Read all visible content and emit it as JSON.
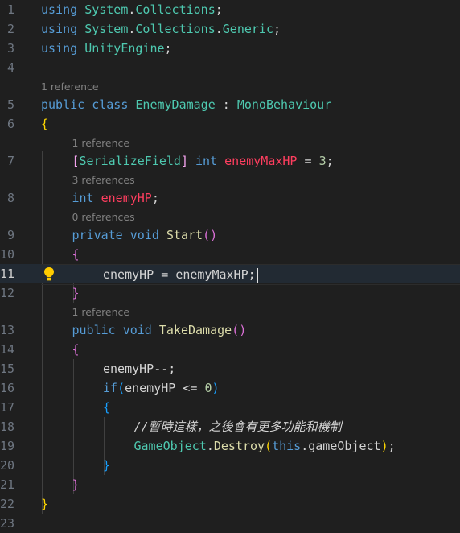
{
  "editor": {
    "language": "C#",
    "current_line": 11,
    "colors": {
      "background": "#1f1f1f",
      "keyword": "#569cd6",
      "type": "#4ec9b0",
      "field": "#ff3e5f",
      "method": "#dcdcaa",
      "number": "#b5cea8",
      "attribute_bracket": "#f2a2ec",
      "bracket_level1": "#ffd700",
      "bracket_level2": "#da70d6",
      "bracket_level3": "#179fff",
      "codelens": "#808080",
      "line_number": "#6e7681"
    },
    "icons": {
      "lightbulb": "lightbulb-icon"
    },
    "lines": [
      {
        "n": "1",
        "indent": 0,
        "tokens": [
          {
            "t": "using ",
            "c": "kw"
          },
          {
            "t": "System",
            "c": "ns"
          },
          {
            "t": ".",
            "c": "op"
          },
          {
            "t": "Collections",
            "c": "ns"
          },
          {
            "t": ";",
            "c": "op"
          }
        ]
      },
      {
        "n": "2",
        "indent": 0,
        "tokens": [
          {
            "t": "using ",
            "c": "kw"
          },
          {
            "t": "System",
            "c": "ns"
          },
          {
            "t": ".",
            "c": "op"
          },
          {
            "t": "Collections",
            "c": "ns"
          },
          {
            "t": ".",
            "c": "op"
          },
          {
            "t": "Generic",
            "c": "ns"
          },
          {
            "t": ";",
            "c": "op"
          }
        ]
      },
      {
        "n": "3",
        "indent": 0,
        "tokens": [
          {
            "t": "using ",
            "c": "kw"
          },
          {
            "t": "UnityEngine",
            "c": "ns"
          },
          {
            "t": ";",
            "c": "op"
          }
        ]
      },
      {
        "n": "4",
        "indent": 0,
        "tokens": []
      },
      {
        "n": "5",
        "indent": 0,
        "lens": "1 reference",
        "tokens": [
          {
            "t": "public ",
            "c": "kw"
          },
          {
            "t": "class ",
            "c": "kw"
          },
          {
            "t": "EnemyDamage",
            "c": "ty"
          },
          {
            "t": " : ",
            "c": "op"
          },
          {
            "t": "MonoBehaviour",
            "c": "ty"
          }
        ]
      },
      {
        "n": "6",
        "indent": 0,
        "tokens": [
          {
            "t": "{",
            "c": "b1"
          }
        ]
      },
      {
        "n": "7",
        "indent": 1,
        "lens": "1 reference",
        "tokens": [
          {
            "t": "[",
            "c": "attr"
          },
          {
            "t": "SerializeField",
            "c": "ty"
          },
          {
            "t": "]",
            "c": "attr"
          },
          {
            "t": " int ",
            "c": "kw"
          },
          {
            "t": "enemyMaxHP",
            "c": "fld"
          },
          {
            "t": " = ",
            "c": "op"
          },
          {
            "t": "3",
            "c": "num"
          },
          {
            "t": ";",
            "c": "op"
          }
        ]
      },
      {
        "n": "8",
        "indent": 1,
        "lens": "3 references",
        "tokens": [
          {
            "t": "int ",
            "c": "kw"
          },
          {
            "t": "enemyHP",
            "c": "fld"
          },
          {
            "t": ";",
            "c": "op"
          }
        ]
      },
      {
        "n": "9",
        "indent": 1,
        "lens": "0 references",
        "tokens": [
          {
            "t": "private ",
            "c": "kw"
          },
          {
            "t": "void ",
            "c": "kw"
          },
          {
            "t": "Start",
            "c": "fn"
          },
          {
            "t": "()",
            "c": "b2"
          }
        ]
      },
      {
        "n": "10",
        "indent": 1,
        "tokens": [
          {
            "t": "{",
            "c": "b2"
          }
        ]
      },
      {
        "n": "11",
        "indent": 2,
        "tokens": [
          {
            "t": "enemyHP",
            "c": "plain"
          },
          {
            "t": " = ",
            "c": "op"
          },
          {
            "t": "enemyMaxHP",
            "c": "plain"
          },
          {
            "t": ";",
            "c": "op"
          }
        ]
      },
      {
        "n": "12",
        "indent": 1,
        "tokens": [
          {
            "t": "}",
            "c": "b2"
          }
        ]
      },
      {
        "n": "13",
        "indent": 1,
        "lens": "1 reference",
        "tokens": [
          {
            "t": "public ",
            "c": "kw"
          },
          {
            "t": "void ",
            "c": "kw"
          },
          {
            "t": "TakeDamage",
            "c": "fn"
          },
          {
            "t": "()",
            "c": "b2"
          }
        ]
      },
      {
        "n": "14",
        "indent": 1,
        "tokens": [
          {
            "t": "{",
            "c": "b2"
          }
        ]
      },
      {
        "n": "15",
        "indent": 2,
        "tokens": [
          {
            "t": "enemyHP",
            "c": "plain"
          },
          {
            "t": "--;",
            "c": "op"
          }
        ]
      },
      {
        "n": "16",
        "indent": 2,
        "tokens": [
          {
            "t": "if",
            "c": "kw"
          },
          {
            "t": "(",
            "c": "b3"
          },
          {
            "t": "enemyHP",
            "c": "plain"
          },
          {
            "t": " <= ",
            "c": "op"
          },
          {
            "t": "0",
            "c": "num"
          },
          {
            "t": ")",
            "c": "b3"
          }
        ]
      },
      {
        "n": "17",
        "indent": 2,
        "tokens": [
          {
            "t": "{",
            "c": "b3"
          }
        ]
      },
      {
        "n": "18",
        "indent": 3,
        "tokens": [
          {
            "t": "//暫時這樣，之後會有更多功能和機制",
            "c": "cm"
          }
        ]
      },
      {
        "n": "19",
        "indent": 3,
        "tokens": [
          {
            "t": "GameObject",
            "c": "ty"
          },
          {
            "t": ".",
            "c": "op"
          },
          {
            "t": "Destroy",
            "c": "fn"
          },
          {
            "t": "(",
            "c": "b1"
          },
          {
            "t": "this",
            "c": "kw"
          },
          {
            "t": ".",
            "c": "op"
          },
          {
            "t": "gameObject",
            "c": "plain"
          },
          {
            "t": ")",
            "c": "b1"
          },
          {
            "t": ";",
            "c": "op"
          }
        ]
      },
      {
        "n": "20",
        "indent": 2,
        "tokens": [
          {
            "t": "}",
            "c": "b3"
          }
        ]
      },
      {
        "n": "21",
        "indent": 1,
        "tokens": [
          {
            "t": "}",
            "c": "b2"
          }
        ]
      },
      {
        "n": "22",
        "indent": 0,
        "tokens": [
          {
            "t": "}",
            "c": "b1"
          }
        ]
      },
      {
        "n": "23",
        "indent": 0,
        "tokens": []
      }
    ]
  }
}
